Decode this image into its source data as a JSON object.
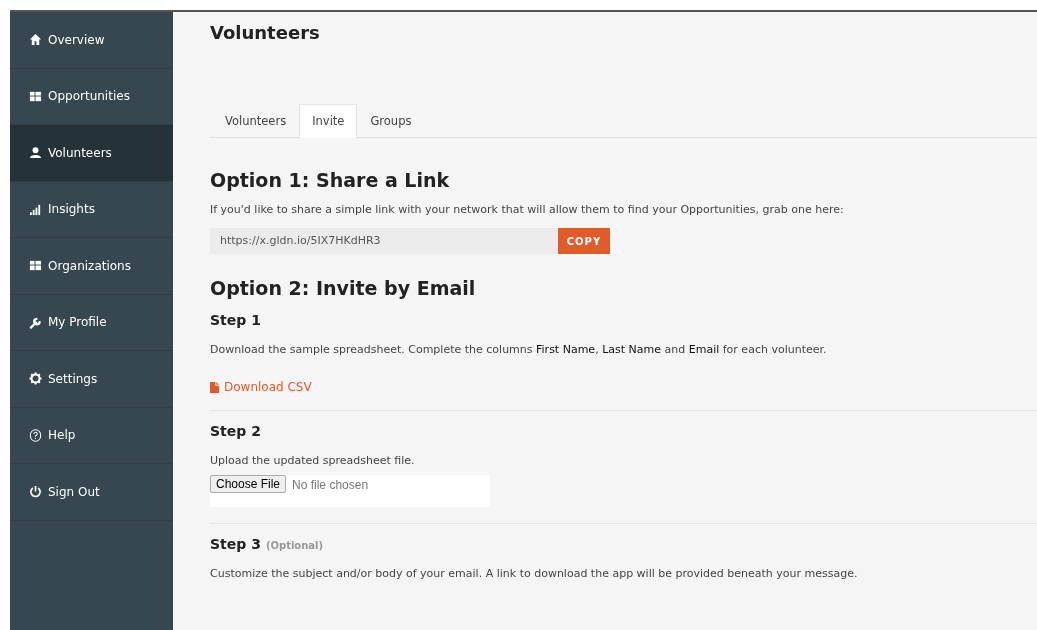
{
  "sidebar": {
    "items": [
      {
        "label": "Overview",
        "selected": false
      },
      {
        "label": "Opportunities",
        "selected": false
      },
      {
        "label": "Volunteers",
        "selected": true
      },
      {
        "label": "Insights",
        "selected": false
      },
      {
        "label": "Organizations",
        "selected": false
      },
      {
        "label": "My Profile",
        "selected": false
      },
      {
        "label": "Settings",
        "selected": false
      },
      {
        "label": "Help",
        "selected": false
      },
      {
        "label": "Sign Out",
        "selected": false
      }
    ]
  },
  "page_title": "Volunteers",
  "tabs": [
    {
      "label": "Volunteers",
      "selected": false
    },
    {
      "label": "Invite",
      "selected": true
    },
    {
      "label": "Groups",
      "selected": false
    }
  ],
  "option1": {
    "heading": "Option 1: Share a Link",
    "description": "If you'd like to share a simple link with your network that will allow them to find your Opportunities, grab one here:",
    "link_field": {
      "value": "https://x.gldn.io/5IX7HKdHR3"
    },
    "copy_button": "COPY"
  },
  "option2": {
    "heading": "Option 2: Invite by Email",
    "steps": [
      {
        "title": "Step 1",
        "description": "Download the sample spreadsheet. Complete the columns **First Name**, **Last Name** and **Email** for each volunteer.",
        "download_link": "Download CSV"
      },
      {
        "title": "Step 2",
        "description": "Upload the updated spreadsheet file.",
        "file_input": {
          "button": "Choose File",
          "status": "No file chosen"
        }
      },
      {
        "title": "Step 3",
        "note": "(Optional)",
        "description": "Customize the subject and/or body of your email. A link to download the app will be provided beneath your message."
      }
    ]
  }
}
